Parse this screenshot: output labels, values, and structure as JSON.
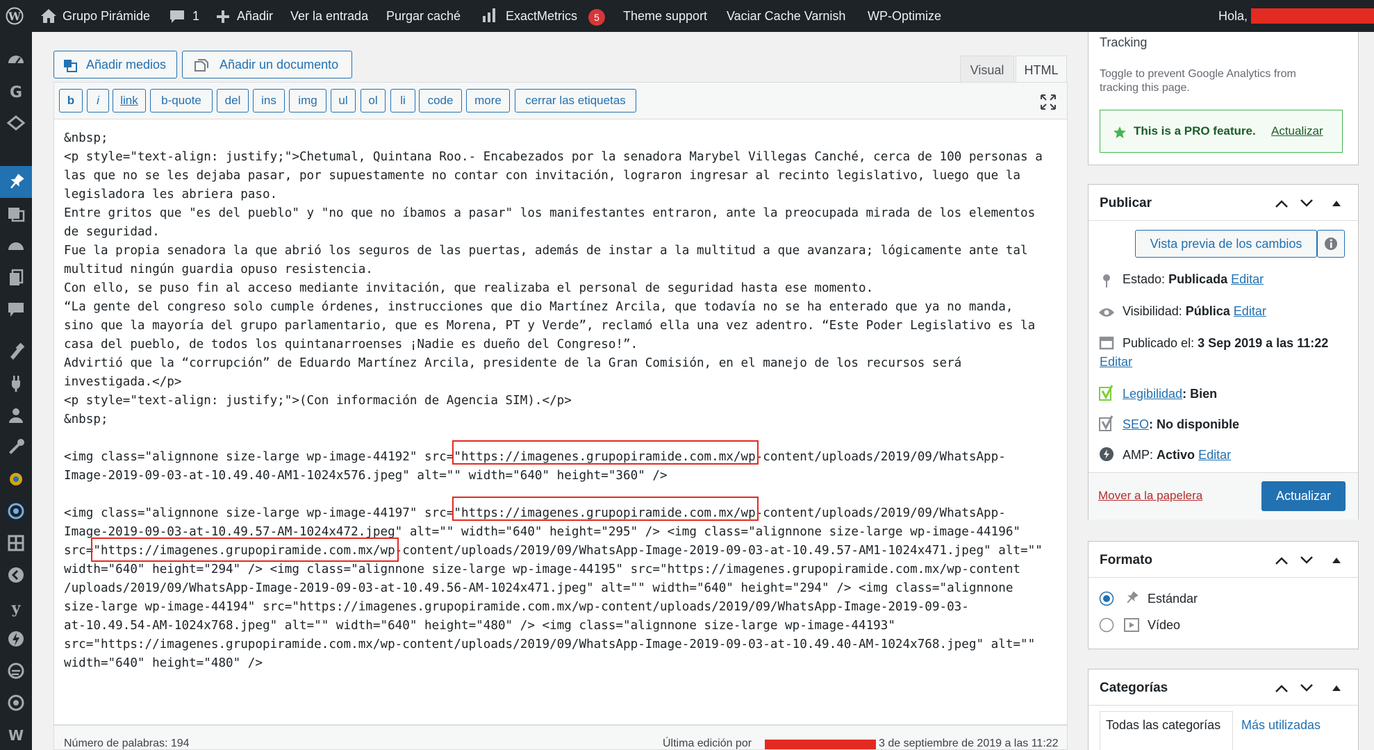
{
  "adminbar": {
    "site": "Grupo Pirámide",
    "comments": "1",
    "add_new": "Añadir",
    "view_post": "Ver la entrada",
    "purge_cache": "Purgar caché",
    "exactmetrics": "ExactMetrics",
    "exactmetrics_badge": "5",
    "theme_support": "Theme support",
    "varnish": "Vaciar Cache Varnish",
    "wpoptimize": "WP-Optimize",
    "greeting": "Hola,"
  },
  "media": {
    "add_media": "Añadir medios",
    "add_document": "Añadir un documento"
  },
  "tabs": {
    "visual": "Visual",
    "html": "HTML"
  },
  "quicktags": [
    "b",
    "i",
    "link",
    "b-quote",
    "del",
    "ins",
    "img",
    "ul",
    "ol",
    "li",
    "code",
    "more",
    "cerrar las etiquetas"
  ],
  "editor_lines": [
    "&nbsp;",
    "<p style=\"text-align: justify;\">Chetumal, Quintana Roo.- Encabezados por la senadora Marybel Villegas Canché, cerca de 100 personas a",
    "las que no se les dejaba pasar, por supuestamente no contar con invitación, lograron ingresar al recinto legislativo, luego que la",
    "legisladora les abriera paso.",
    "Entre gritos que \"es del pueblo\" y \"no que no íbamos a pasar\" los manifestantes entraron, ante la preocupada mirada de los elementos",
    "de seguridad.",
    "Fue la propia senadora la que abrió los seguros de las puertas, además de instar a la multitud a que avanzara; lógicamente ante tal",
    "multitud ningún guardia opuso resistencia.",
    "Con ello, se puso fin al acceso mediante invitación, que realizaba el personal de seguridad hasta ese momento.",
    "“La gente del congreso solo cumple órdenes, instrucciones que dio Martínez Arcila, que todavía no se ha enterado que ya no manda,",
    "sino que la mayoría del grupo parlamentario, que es Morena, PT y Verde”, reclamó ella una vez adentro. “Este Poder Legislativo es la",
    "casa del pueblo, de todos los quintanarroenses ¡Nadie es dueño del Congreso!”.",
    "Advirtió que la “corrupción” de Eduardo Martínez Arcila, presidente de la Gran Comisión, en el manejo de los recursos será",
    "investigada.</p>",
    "<p style=\"text-align: justify;\">(Con información de Agencia SIM).</p>",
    "&nbsp;",
    "",
    "<img class=\"alignnone size-large wp-image-44192\" src=\"https://imagenes.grupopiramide.com.mx/wp-content/uploads/2019/09/WhatsApp-",
    "Image-2019-09-03-at-10.49.40-AM1-1024x576.jpeg\" alt=\"\" width=\"640\" height=\"360\" />",
    "",
    "<img class=\"alignnone size-large wp-image-44197\" src=\"https://imagenes.grupopiramide.com.mx/wp-content/uploads/2019/09/WhatsApp-",
    "Image-2019-09-03-at-10.49.57-AM-1024x472.jpeg\" alt=\"\" width=\"640\" height=\"295\" /> <img class=\"alignnone size-large wp-image-44196\"",
    "src=\"https://imagenes.grupopiramide.com.mx/wp-content/uploads/2019/09/WhatsApp-Image-2019-09-03-at-10.49.57-AM1-1024x471.jpeg\" alt=\"\"",
    "width=\"640\" height=\"294\" /> <img class=\"alignnone size-large wp-image-44195\" src=\"https://imagenes.grupopiramide.com.mx/wp-content",
    "/uploads/2019/09/WhatsApp-Image-2019-09-03-at-10.49.56-AM-1024x471.jpeg\" alt=\"\" width=\"640\" height=\"294\" /> <img class=\"alignnone",
    "size-large wp-image-44194\" src=\"https://imagenes.grupopiramide.com.mx/wp-content/uploads/2019/09/WhatsApp-Image-2019-09-03-",
    "at-10.49.54-AM-1024x768.jpeg\" alt=\"\" width=\"640\" height=\"480\" /> <img class=\"alignnone size-large wp-image-44193\"",
    "src=\"https://imagenes.grupopiramide.com.mx/wp-content/uploads/2019/09/WhatsApp-Image-2019-09-03-at-10.49.40-AM-1024x768.jpeg\" alt=\"\"",
    "width=\"640\" height=\"480\" />"
  ],
  "status": {
    "word_count": "Número de palabras: 194",
    "last_edit_prefix": "Última edición por",
    "last_edit_date": "3 de septiembre de 2019 a las 11:22"
  },
  "tracking": {
    "title": "Tracking",
    "desc": "Toggle to prevent Google Analytics from tracking this page.",
    "pro": "This is a PRO feature.",
    "upgrade": "Actualizar"
  },
  "publish": {
    "title": "Publicar",
    "preview": "Vista previa de los cambios",
    "status_label": "Estado:",
    "status_value": "Publicada",
    "visibility_label": "Visibilidad:",
    "visibility_value": "Pública",
    "published_label": "Publicado el:",
    "published_value": "3 Sep 2019 a las 11:22",
    "edit": "Editar",
    "readability_label": "Legibilidad",
    "readability_value": ": Bien",
    "seo_label": "SEO",
    "seo_value": ": No disponible",
    "amp_label": "AMP:",
    "amp_value": "Activo",
    "trash": "Mover a la papelera",
    "update": "Actualizar"
  },
  "format": {
    "title": "Formato",
    "standard": "Estándar",
    "video": "Vídeo"
  },
  "categories": {
    "title": "Categorías",
    "all": "Todas las categorías",
    "most_used": "Más utilizadas"
  }
}
